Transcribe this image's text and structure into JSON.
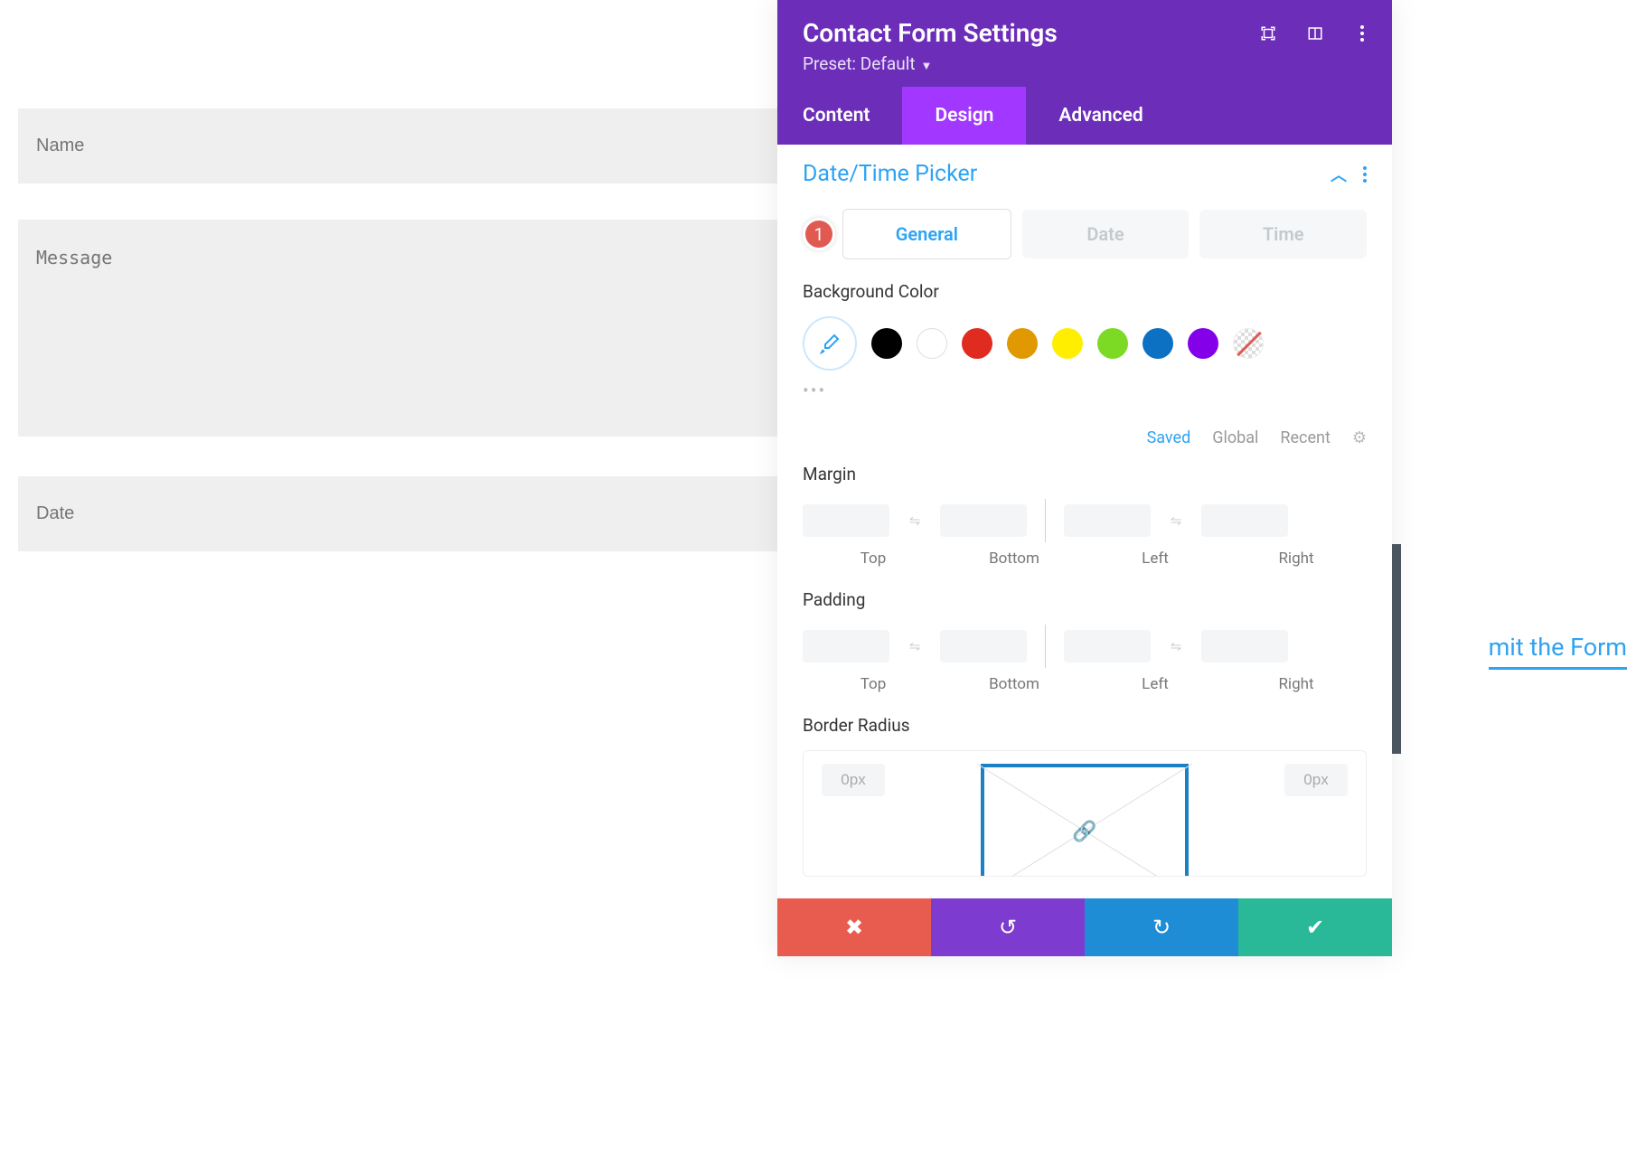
{
  "form": {
    "name_placeholder": "Name",
    "message_placeholder": "Message",
    "date_placeholder": "Date",
    "submit_label": "mit the Form"
  },
  "panel": {
    "title": "Contact Form Settings",
    "subtitle": "Preset: Default",
    "tabs": [
      "Content",
      "Design",
      "Advanced"
    ],
    "active_tab": 1,
    "section": "Date/Time Picker",
    "marker": "1",
    "subtabs": [
      "General",
      "Date",
      "Time"
    ],
    "bg_label": "Background Color",
    "colors": [
      "#000000",
      "#ffffff",
      "#e02b20",
      "#edb059",
      "#ffee00",
      "#7cda24",
      "#0c71c3",
      "#8300e9"
    ],
    "palette_tabs": [
      "Saved",
      "Global",
      "Recent"
    ],
    "margin_label": "Margin",
    "padding_label": "Padding",
    "spacing_sides": [
      "Top",
      "Bottom",
      "Left",
      "Right"
    ],
    "radius_label": "Border Radius",
    "radius_values": {
      "tl": "0px",
      "tr": "0px"
    }
  }
}
